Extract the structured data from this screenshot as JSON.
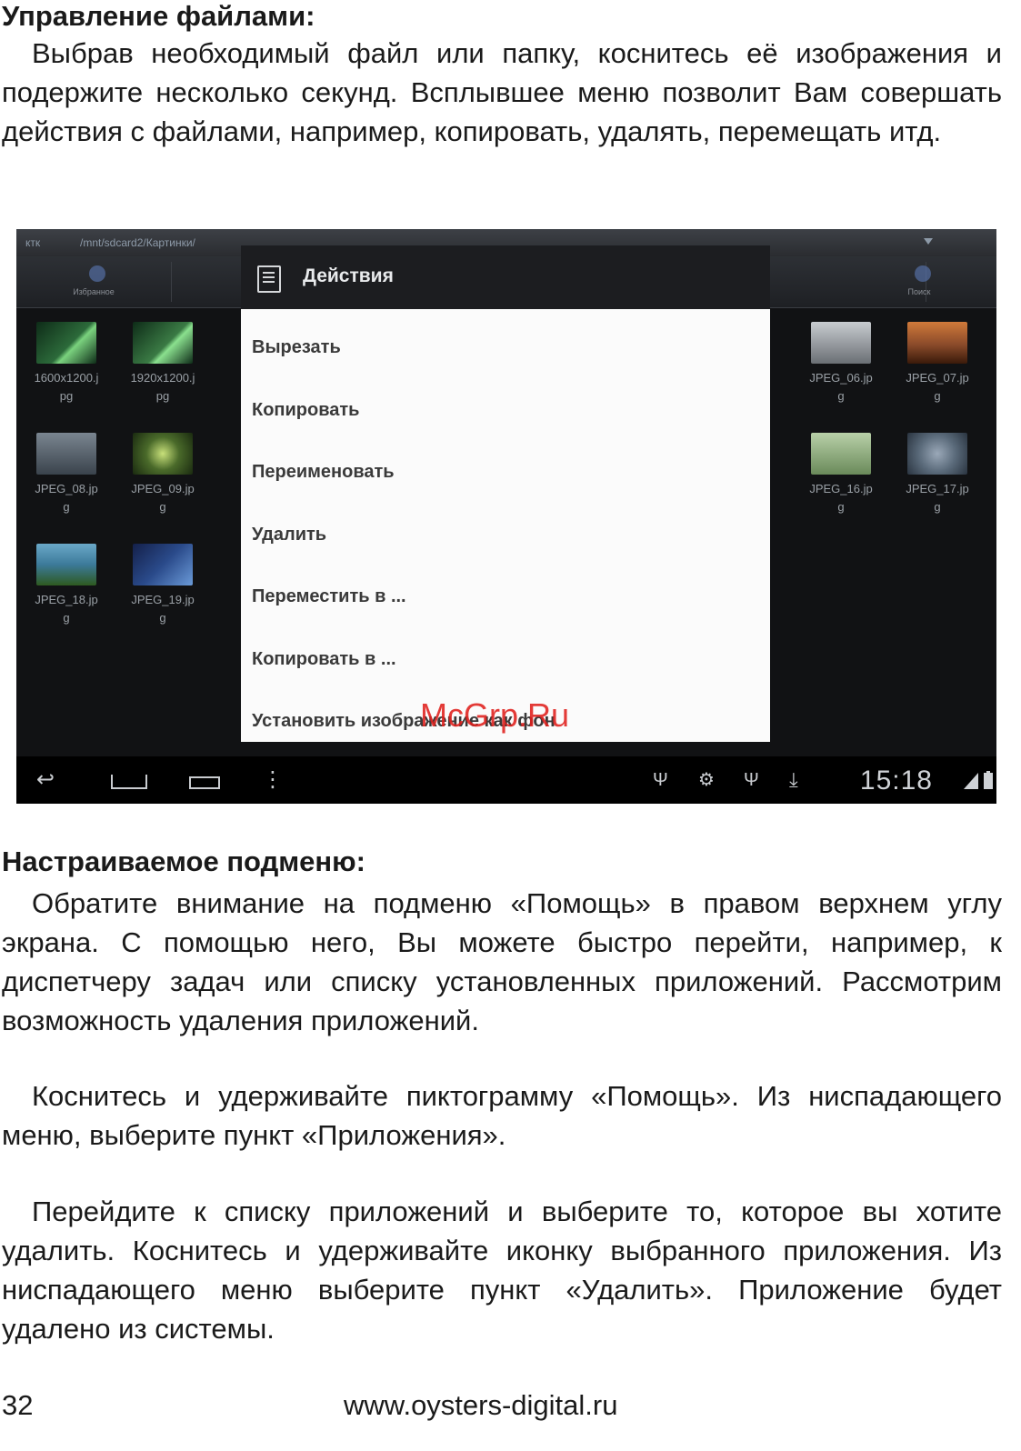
{
  "section1": {
    "heading": "Управление файлами:",
    "paragraph": "Выбрав необходимый файл или папку, коснитесь её изображения и подержите несколько секунд. Всплывшее меню позволит Вам совершать действия с файлами, например, копировать, удалять, перемещать итд."
  },
  "screenshot": {
    "location": "ктк",
    "path": "/mnt/sdcard2/Картинки/",
    "toolbar": [
      "Избранное",
      "",
      "",
      "",
      "",
      "Поиск"
    ],
    "files_left": [
      {
        "line1": "1600x1200.j",
        "line2": "pg",
        "color": "#2c6a3a"
      },
      {
        "line1": "1920x1200.j",
        "line2": "pg",
        "color": "#3a7a44"
      },
      {
        "line1": "JPEG_08.jp",
        "line2": "g",
        "color": "#55606a"
      },
      {
        "line1": "JPEG_09.jp",
        "line2": "g",
        "color": "#4a6a2a"
      },
      {
        "line1": "JPEG_18.jp",
        "line2": "g",
        "color": "#3c7a9a"
      },
      {
        "line1": "JPEG_19.jp",
        "line2": "g",
        "color": "#2a4a8a"
      }
    ],
    "files_right": [
      {
        "line1": "JPEG_06.jp",
        "line2": "g",
        "color": "#8a8f94"
      },
      {
        "line1": "JPEG_07.jp",
        "line2": "g",
        "color": "#8a4a2a"
      },
      {
        "line1": "JPEG_16.jp",
        "line2": "g",
        "color": "#6a8a5a"
      },
      {
        "line1": "JPEG_17.jp",
        "line2": "g",
        "color": "#5a6a7a"
      }
    ],
    "dialog": {
      "title": "Действия",
      "items": [
        "Вырезать",
        "Копировать",
        "Переименовать",
        "Удалить",
        "Переместить в ...",
        "Копировать в ...",
        "Установить изображение как фон"
      ]
    },
    "time": "15:18",
    "watermark": "McGrp.Ru"
  },
  "section2": {
    "heading": "Настраиваемое подменю:",
    "p1": "Обратите внимание на подменю «Помощь» в правом верхнем углу экрана. С помощью него, Вы можете быстро перейти, например, к диспетчеру задач или списку установленных приложений. Рассмотрим возможность удаления приложений.",
    "p2": "Коснитесь и удерживайте пиктограмму «Помощь». Из ниспадающего меню, выберите пункт «Приложения».",
    "p3": "Перейдите к списку приложений и выберите то, которое вы хотите удалить. Коснитесь и удерживайте иконку выбранного приложения. Из ниспадающего меню выберите пункт «Удалить». Приложение будет удалено из системы."
  },
  "footer": {
    "page_number": "32",
    "url": "www.oysters-digital.ru"
  }
}
